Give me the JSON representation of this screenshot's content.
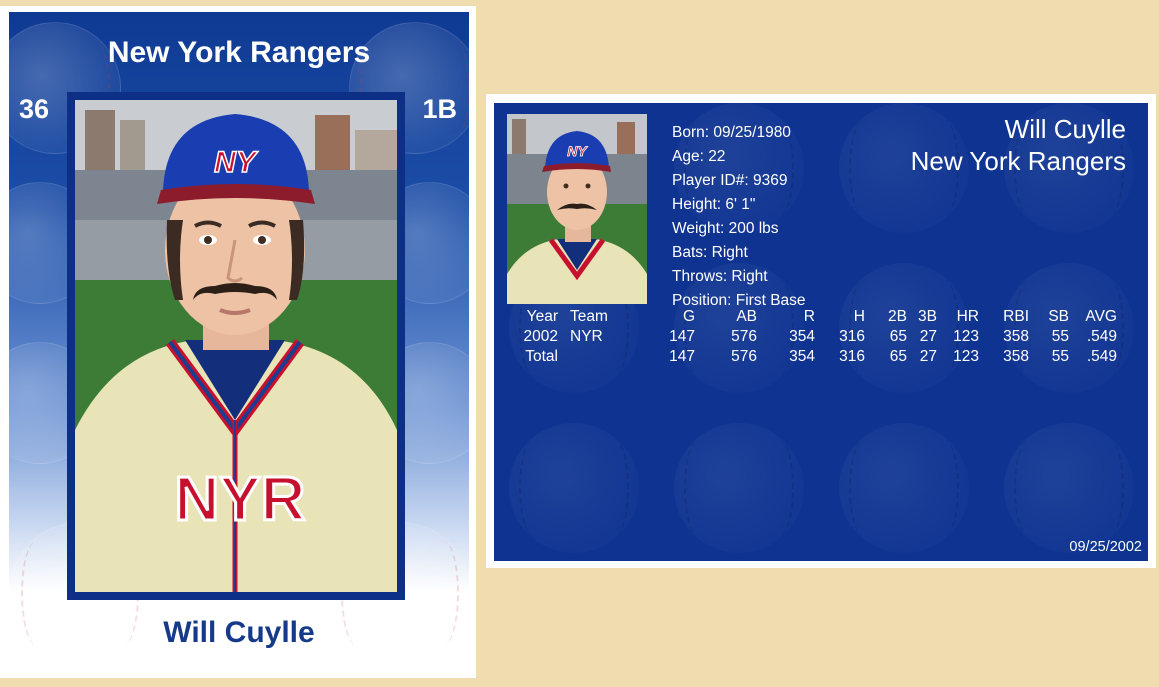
{
  "front": {
    "team": "New York Rangers",
    "number": "36",
    "position": "1B",
    "player_name": "Will Cuylle",
    "cap_logo_text": "NY",
    "jersey_text": "NYR"
  },
  "back": {
    "name": "Will Cuylle",
    "team": "New York Rangers",
    "bio": {
      "born": "Born: 09/25/1980",
      "age": "Age: 22",
      "player_id": "Player ID#: 9369",
      "height": "Height: 6' 1\"",
      "weight": "Weight: 200 lbs",
      "bats": "Bats: Right",
      "throws": "Throws: Right",
      "position": "Position: First Base"
    },
    "stats": {
      "headers": [
        "Year",
        "Team",
        "G",
        "AB",
        "R",
        "H",
        "2B",
        "3B",
        "HR",
        "RBI",
        "SB",
        "AVG"
      ],
      "rows": [
        [
          "2002",
          "NYR",
          "147",
          "576",
          "354",
          "316",
          "65",
          "27",
          "123",
          "358",
          "55",
          ".549"
        ],
        [
          "Total",
          "",
          "147",
          "576",
          "354",
          "316",
          "65",
          "27",
          "123",
          "358",
          "55",
          ".549"
        ]
      ]
    },
    "date": "09/25/2002"
  },
  "colors": {
    "background": "#efddb0",
    "card_blue": "#0e3391",
    "name_blue": "#163a8a",
    "jersey_red": "#c8102e",
    "jersey_cream": "#e9e4b8"
  }
}
